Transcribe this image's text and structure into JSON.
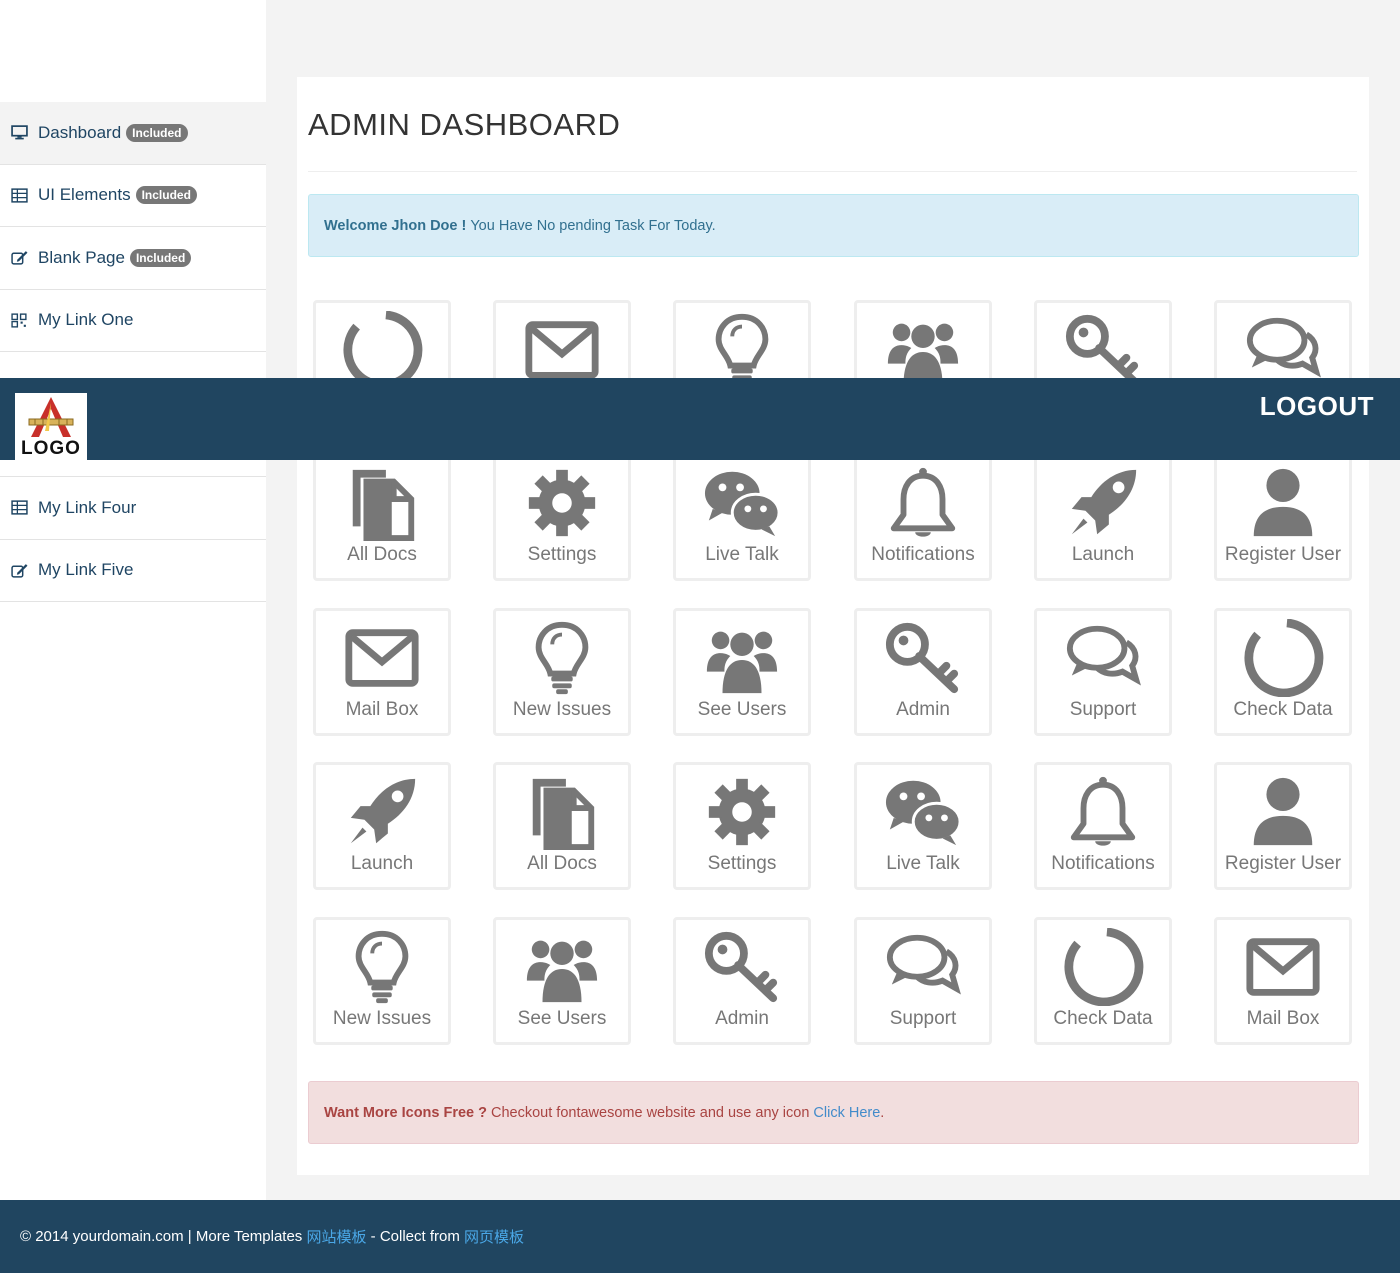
{
  "sidebar": {
    "items": [
      {
        "label": "Dashboard",
        "icon": "desktop-icon",
        "badge": "Included"
      },
      {
        "label": "UI Elements",
        "icon": "table-icon",
        "badge": "Included"
      },
      {
        "label": "Blank Page",
        "icon": "edit-icon",
        "badge": "Included"
      },
      {
        "label": "My Link One",
        "icon": "qrcode-icon"
      },
      {
        "label": "My Link Four",
        "icon": "table-icon"
      },
      {
        "label": "My Link Five",
        "icon": "edit-icon"
      }
    ]
  },
  "header": {
    "logo_text": "LOGO",
    "logout_label": "LOGOUT"
  },
  "main": {
    "title": "ADMIN DASHBOARD",
    "welcome": {
      "bold": "Welcome Jhon Doe !",
      "text": "You Have No pending Task For Today."
    },
    "tiles_row0": [
      {
        "icon": "circle-notch-icon"
      },
      {
        "icon": "envelope-icon"
      },
      {
        "icon": "lightbulb-icon"
      },
      {
        "icon": "users-icon"
      },
      {
        "icon": "key-icon"
      },
      {
        "icon": "comments-icon"
      }
    ],
    "tiles_row1": [
      {
        "label": "All Docs",
        "icon": "files-icon"
      },
      {
        "label": "Settings",
        "icon": "gear-icon"
      },
      {
        "label": "Live Talk",
        "icon": "wechat-icon"
      },
      {
        "label": "Notifications",
        "icon": "bell-icon"
      },
      {
        "label": "Launch",
        "icon": "rocket-icon"
      },
      {
        "label": "Register User",
        "icon": "user-icon"
      }
    ],
    "tiles_row2": [
      {
        "label": "Mail Box",
        "icon": "envelope-icon"
      },
      {
        "label": "New Issues",
        "icon": "lightbulb-icon"
      },
      {
        "label": "See Users",
        "icon": "users-icon"
      },
      {
        "label": "Admin",
        "icon": "key-icon"
      },
      {
        "label": "Support",
        "icon": "comments-icon"
      },
      {
        "label": "Check Data",
        "icon": "circle-notch-icon"
      }
    ],
    "tiles_row3": [
      {
        "label": "Launch",
        "icon": "rocket-icon"
      },
      {
        "label": "All Docs",
        "icon": "files-icon"
      },
      {
        "label": "Settings",
        "icon": "gear-icon"
      },
      {
        "label": "Live Talk",
        "icon": "wechat-icon"
      },
      {
        "label": "Notifications",
        "icon": "bell-icon"
      },
      {
        "label": "Register User",
        "icon": "user-icon"
      }
    ],
    "tiles_row4": [
      {
        "label": "New Issues",
        "icon": "lightbulb-icon"
      },
      {
        "label": "See Users",
        "icon": "users-icon"
      },
      {
        "label": "Admin",
        "icon": "key-icon"
      },
      {
        "label": "Support",
        "icon": "comments-icon"
      },
      {
        "label": "Check Data",
        "icon": "circle-notch-icon"
      },
      {
        "label": "Mail Box",
        "icon": "envelope-icon"
      }
    ],
    "promo": {
      "bold": "Want More Icons Free ?",
      "text": "Checkout fontawesome website and use any icon",
      "link": "Click Here",
      "suffix": "."
    }
  },
  "footer": {
    "copyright": "© 2014 yourdomain.com | More Templates ",
    "link1": "网站模板",
    "mid": " - Collect from ",
    "link2": "网页模板"
  }
}
